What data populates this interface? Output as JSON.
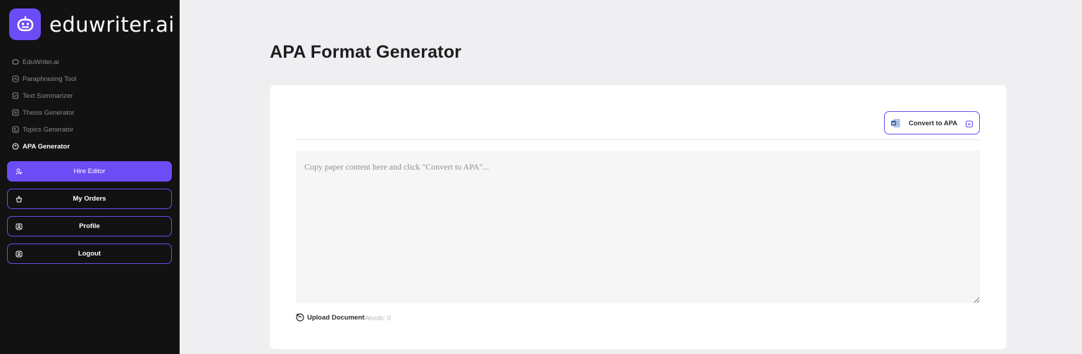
{
  "brand": {
    "name": "eduwriter.ai",
    "logo_icon": "robot-face-icon",
    "accent": "#6c4cf5"
  },
  "sidebar": {
    "nav": [
      {
        "label": "EduWriter.ai",
        "icon": "brand-icon"
      },
      {
        "label": "Paraphrasing Tool",
        "icon": "paraphrase-icon"
      },
      {
        "label": "Text Summarizer",
        "icon": "summarizer-icon"
      },
      {
        "label": "Thesis Generator",
        "icon": "thesis-icon"
      },
      {
        "label": "Topics Generator",
        "icon": "topics-icon"
      },
      {
        "label": "APA Generator",
        "icon": "apa-icon",
        "active": true
      }
    ],
    "buttons": [
      {
        "label": "Hire Editor",
        "icon": "user-plus-icon",
        "primary": true
      },
      {
        "label": "My Orders",
        "icon": "basket-icon"
      },
      {
        "label": "Profile",
        "icon": "profile-icon"
      },
      {
        "label": "Logout",
        "icon": "logout-icon"
      }
    ]
  },
  "main": {
    "title": "APA Format Generator",
    "convert_button": {
      "label": "Convert to APA",
      "icon": "word-doc-icon",
      "end_icon": "inbox-download-icon"
    },
    "editor": {
      "placeholder": "Copy paper content here and click \"Convert to APA\"...",
      "value": ""
    },
    "upload": {
      "label": "Upload Document",
      "icon": "upload-icon"
    },
    "word_count": "Words: 0"
  }
}
